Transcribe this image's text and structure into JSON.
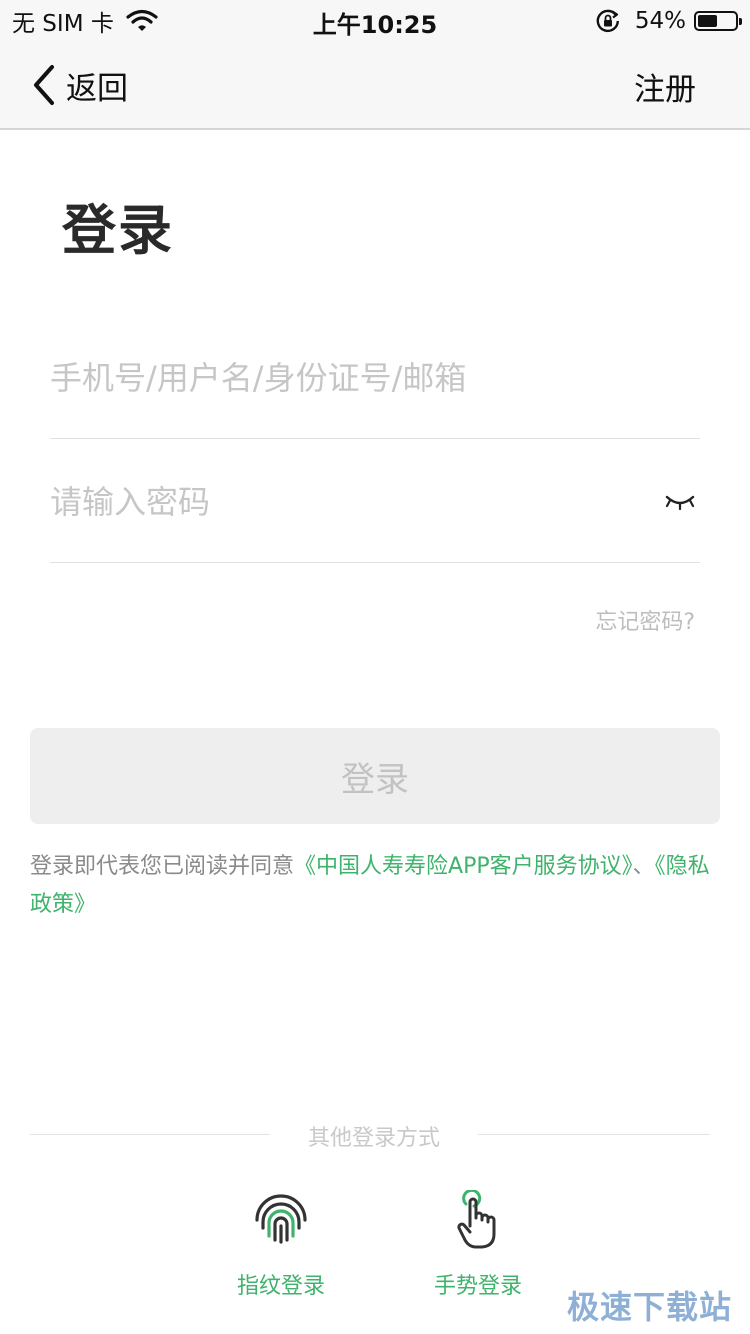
{
  "status_bar": {
    "carrier": "无 SIM 卡",
    "time": "上午10:25",
    "battery_text": "54%",
    "battery_level": 0.54
  },
  "nav": {
    "back_label": "返回",
    "register_label": "注册"
  },
  "title": "登录",
  "form": {
    "account_placeholder": "手机号/用户名/身份证号/邮箱",
    "account_value": "",
    "password_placeholder": "请输入密码",
    "password_value": "",
    "forgot_label": "忘记密码?",
    "login_button": "登录"
  },
  "agreement": {
    "prefix": "登录即代表您已阅读并同意",
    "service_link": "《中国人寿寿险APP客户服务协议》",
    "separator": "、",
    "privacy_link": "《隐私政策》"
  },
  "other_login": {
    "title": "其他登录方式",
    "methods": [
      {
        "label": "指纹登录",
        "icon": "fingerprint-icon"
      },
      {
        "label": "手势登录",
        "icon": "hand-gesture-icon"
      }
    ]
  },
  "watermark": "极速下载站",
  "colors": {
    "accent_green": "#3fb36b",
    "disabled_button": "#eeeeee",
    "disabled_button_text": "#c2c2c2",
    "nav_background": "#f7f7f7"
  }
}
